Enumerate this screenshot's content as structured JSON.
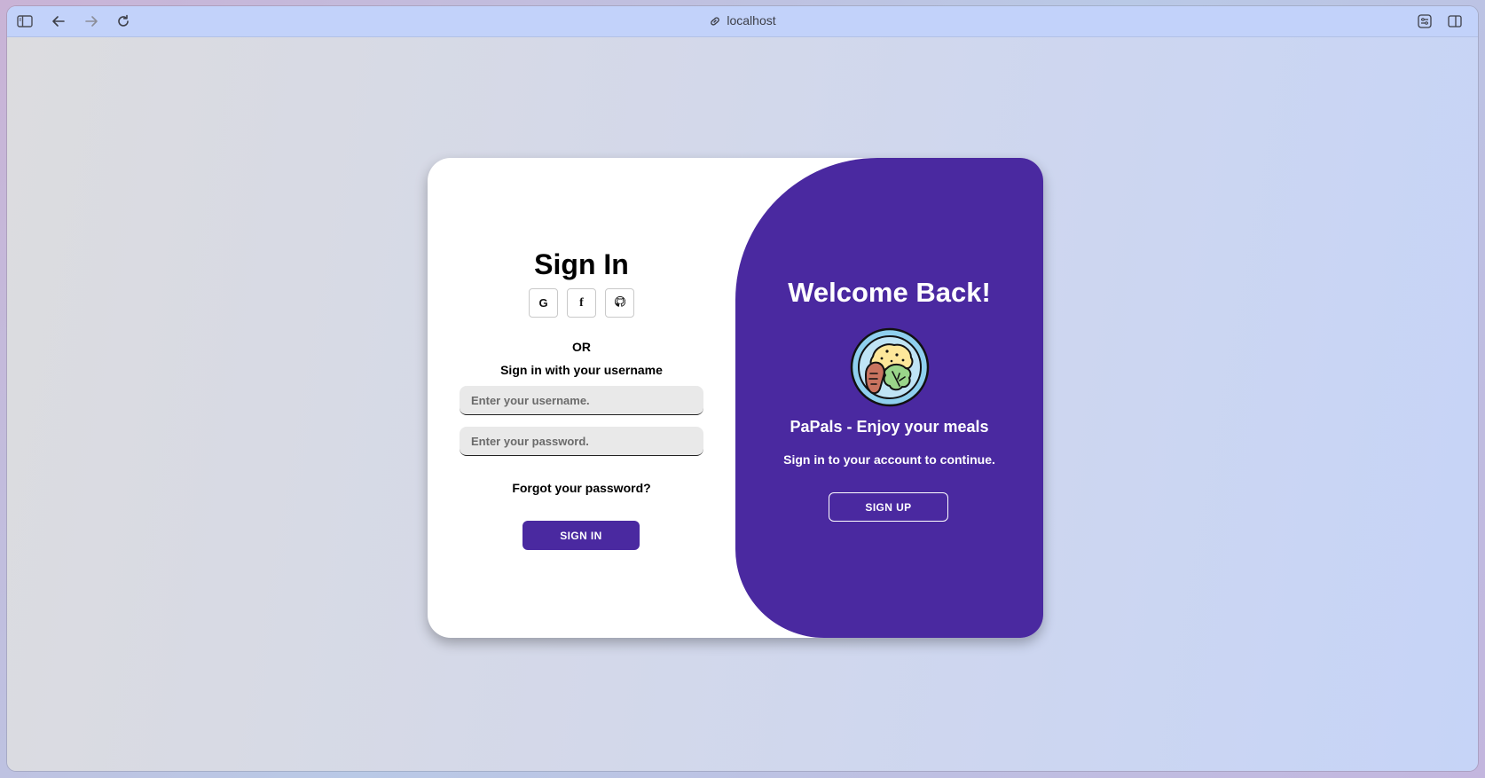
{
  "browser": {
    "url": "localhost",
    "icons": [
      "sidebar-icon",
      "back-icon",
      "forward-icon",
      "reload-icon",
      "link-icon",
      "extensions-icon",
      "split-view-icon"
    ]
  },
  "signin": {
    "title": "Sign In",
    "social_buttons": [
      {
        "label": "G",
        "icon": "google-icon"
      },
      {
        "label": "f",
        "icon": "facebook-icon"
      },
      {
        "label": "",
        "icon": "github-icon"
      }
    ],
    "or_text": "OR",
    "instruction": "Sign in with your username",
    "username_placeholder": "Enter your username.",
    "password_placeholder": "Enter your password.",
    "forgot_link": "Forgot your password?",
    "submit_label": "SIGN IN"
  },
  "welcome": {
    "title": "Welcome Back!",
    "logo_icon": "meal-plate-icon",
    "tagline": "PaPals - Enjoy your meals",
    "subtitle": "Sign in to your account to continue.",
    "signup_label": "SIGN UP"
  },
  "colors": {
    "accent": "#4a29a0",
    "toolbar": "#c2d2fa",
    "input_bg": "#e9e9e9"
  }
}
